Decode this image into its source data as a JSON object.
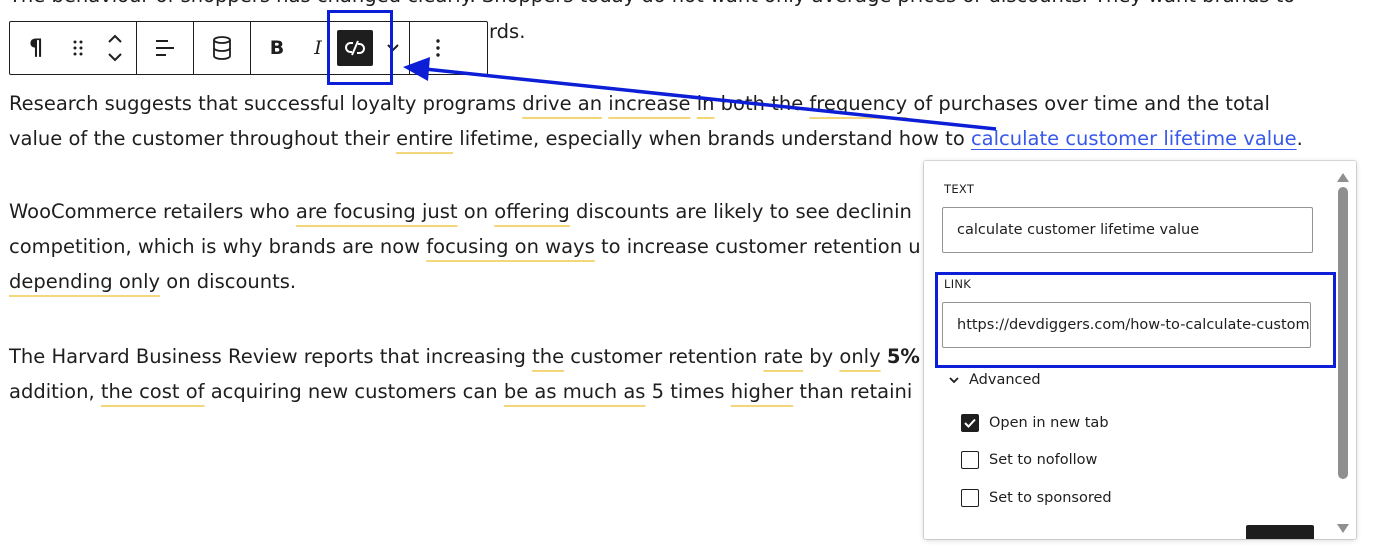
{
  "editor": {
    "top_line": "The behaviour of shoppers has changed clearly. Shoppers today do not want only average prices or discounts. They want brands to",
    "top_tail": "rds.",
    "para1": {
      "line1": [
        "Research suggests that successful loyalty programs ",
        "drive an",
        " ",
        "increase",
        " ",
        "in",
        " both the ",
        "frequency",
        " of purchases over time and the total"
      ],
      "line2": [
        "value of the customer throughout their ",
        "entire",
        " lifetime, especially when brands understand how to ",
        "calculate customer lifetime value",
        "."
      ]
    },
    "para2": {
      "line1": [
        "WooCommerce retailers who ",
        "are focusing just",
        " on ",
        "offering",
        " discounts are likely to see declinin"
      ],
      "line2": [
        "competition, which is why brands are now ",
        "focusing on ways",
        " to increase customer retention u"
      ],
      "line3": [
        "depending only",
        " on discounts."
      ]
    },
    "para3": {
      "line1": [
        "The Harvard Business Review reports that increasing ",
        "the",
        " customer retention ",
        "rate",
        " by ",
        "only",
        " ",
        "5% I"
      ],
      "line2": [
        "addition, ",
        "the cost of",
        " acquiring new customers can ",
        "be as much as",
        " 5 times ",
        "higher",
        " than retaini"
      ]
    }
  },
  "toolbar": {
    "paragraph_icon": "pilcrow-icon",
    "drag_icon": "drag-handle-icon",
    "move_icon": "move-up-down-icon",
    "align_icon": "align-left-icon",
    "database_icon": "database-icon",
    "bold_label": "B",
    "italic_label": "I",
    "link_icon": "unlink-icon",
    "more_rich_icon": "chevron-down-icon",
    "options_icon": "more-vertical-icon"
  },
  "link_popover": {
    "text_label": "TEXT",
    "text_value": "calculate customer lifetime value",
    "link_label": "LINK",
    "link_value": "https://devdiggers.com/how-to-calculate-customer-",
    "advanced_label": "Advanced",
    "options": [
      {
        "label": "Open in new tab",
        "checked": true
      },
      {
        "label": "Set to nofollow",
        "checked": false
      },
      {
        "label": "Set to sponsored",
        "checked": false
      }
    ]
  },
  "colors": {
    "annotation_blue": "#0c1fd6",
    "link_blue": "#3858e9",
    "underline_yellow": "#f3d77a"
  }
}
